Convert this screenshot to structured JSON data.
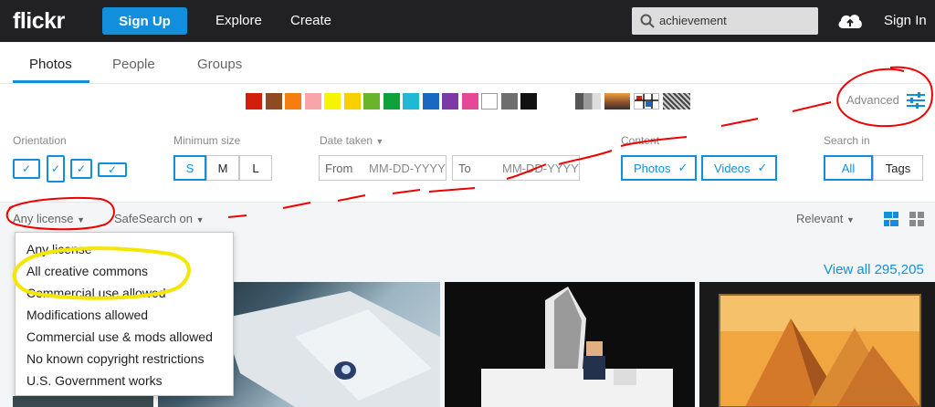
{
  "header": {
    "logo": "flickr",
    "signup_label": "Sign Up",
    "nav": [
      "Explore",
      "Create"
    ],
    "search_value": "achievement",
    "signin_label": "Sign In"
  },
  "tabs": [
    "Photos",
    "People",
    "Groups"
  ],
  "colors": [
    "#d21f0a",
    "#8e4a21",
    "#f57e0e",
    "#f7a5a8",
    "#f7f400",
    "#f8d000",
    "#68b52c",
    "#0da23c",
    "#1fb9d4",
    "#1b68c3",
    "#7b3aa6",
    "#e54896",
    "#ffffff",
    "#6e6e6e",
    "#111111"
  ],
  "advanced_label": "Advanced",
  "filters": {
    "orientation_label": "Orientation",
    "min_size_label": "Minimum size",
    "sizes": [
      "S",
      "M",
      "L"
    ],
    "date_taken_label": "Date taken",
    "from_label": "From",
    "from_placeholder": "MM-DD-YYYY",
    "to_label": "To",
    "to_placeholder": "MM-DD-YYYY",
    "content_label": "Content",
    "photos_label": "Photos",
    "videos_label": "Videos",
    "search_in_label": "Search in",
    "all_label": "All",
    "tags_label": "Tags"
  },
  "toolbar": {
    "license_label": "Any license",
    "safesearch_label": "SafeSearch on",
    "sort_label": "Relevant"
  },
  "results": {
    "view_all": "View all 295,205"
  },
  "license_menu": [
    "Any license",
    "All creative commons",
    "Commercial use allowed",
    "Modifications allowed",
    "Commercial use & mods allowed",
    "No known copyright restrictions",
    "U.S. Government works"
  ]
}
